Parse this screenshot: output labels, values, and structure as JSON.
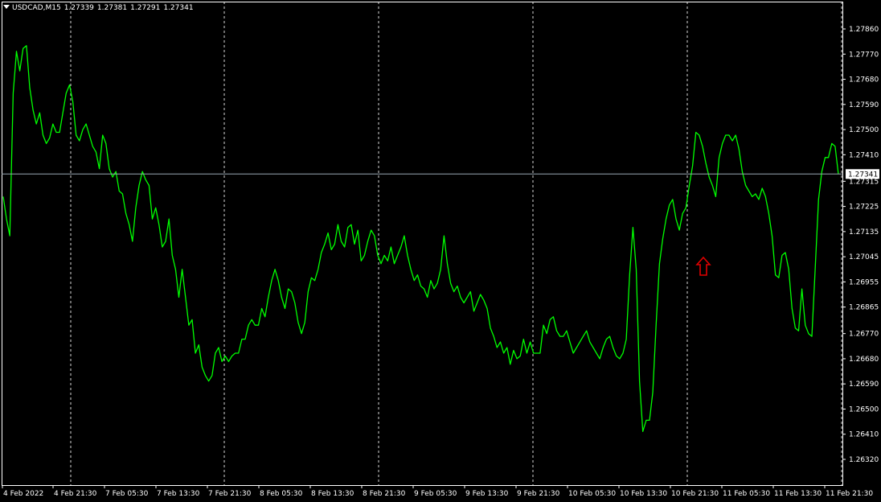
{
  "header": {
    "symbol_timeframe": "USDCAD,M15",
    "open": "1.27339",
    "high": "1.27381",
    "low": "1.27291",
    "close": "1.27341"
  },
  "colors": {
    "background": "#000000",
    "price_line": "#00ff00",
    "grid": "#ffffff",
    "bid_line": "#9aa8b4",
    "arrow": "#e00000",
    "text": "#ffffff"
  },
  "chart_data": {
    "type": "line",
    "symbol": "USDCAD",
    "timeframe": "M15",
    "ylim": [
      1.2632,
      1.2795
    ],
    "yticks": [
      "1.27860",
      "1.27770",
      "1.27680",
      "1.27590",
      "1.27500",
      "1.27410",
      "1.27315",
      "1.27225",
      "1.27135",
      "1.27045",
      "1.26955",
      "1.26865",
      "1.26770",
      "1.26680",
      "1.26590",
      "1.26500",
      "1.26410",
      "1.26320"
    ],
    "x_tick_labels": [
      "4 Feb 2022",
      "4 Feb 21:30",
      "7 Feb 05:30",
      "7 Feb 13:30",
      "7 Feb 21:30",
      "8 Feb 05:30",
      "8 Feb 13:30",
      "8 Feb 21:30",
      "9 Feb 05:30",
      "9 Feb 13:30",
      "9 Feb 21:30",
      "10 Feb 05:30",
      "10 Feb 13:30",
      "10 Feb 21:30",
      "11 Feb 05:30",
      "11 Feb 13:30",
      "11 Feb 21:30"
    ],
    "current_price": "1.27341",
    "grid": "vertical dashed",
    "series": [
      {
        "values": [
          1.2726,
          1.2718,
          1.2712,
          1.2763,
          1.2778,
          1.2771,
          1.2779,
          1.278,
          1.2765,
          1.2757,
          1.2752,
          1.2756,
          1.2748,
          1.2745,
          1.2747,
          1.2752,
          1.2749,
          1.2749,
          1.2756,
          1.2763,
          1.2766,
          1.276,
          1.2748,
          1.2746,
          1.275,
          1.2752,
          1.2748,
          1.2744,
          1.2742,
          1.2736,
          1.2748,
          1.2745,
          1.2736,
          1.2733,
          1.2735,
          1.2728,
          1.2727,
          1.272,
          1.2716,
          1.271,
          1.2722,
          1.273,
          1.2735,
          1.2732,
          1.273,
          1.2718,
          1.2722,
          1.2716,
          1.2708,
          1.271,
          1.2718,
          1.2705,
          1.27,
          1.269,
          1.27,
          1.269,
          1.268,
          1.2682,
          1.267,
          1.2673,
          1.2665,
          1.2662,
          1.266,
          1.2662,
          1.267,
          1.2672,
          1.2667,
          1.2669,
          1.2667,
          1.2669,
          1.267,
          1.267,
          1.2675,
          1.2675,
          1.268,
          1.2682,
          1.268,
          1.268,
          1.2686,
          1.2683,
          1.269,
          1.2696,
          1.27,
          1.2696,
          1.269,
          1.2686,
          1.2693,
          1.2692,
          1.2688,
          1.2681,
          1.2677,
          1.2681,
          1.2692,
          1.2697,
          1.2696,
          1.27,
          1.2706,
          1.2709,
          1.2713,
          1.2707,
          1.2709,
          1.2716,
          1.271,
          1.2708,
          1.2715,
          1.2716,
          1.2709,
          1.2714,
          1.2703,
          1.2705,
          1.271,
          1.2714,
          1.2712,
          1.2705,
          1.2702,
          1.2705,
          1.2703,
          1.2708,
          1.2702,
          1.2705,
          1.2708,
          1.2712,
          1.2705,
          1.27,
          1.2696,
          1.2698,
          1.2694,
          1.2693,
          1.269,
          1.2696,
          1.2693,
          1.2695,
          1.27,
          1.2712,
          1.2702,
          1.2695,
          1.2692,
          1.2694,
          1.269,
          1.2688,
          1.269,
          1.2692,
          1.2685,
          1.2688,
          1.2691,
          1.2689,
          1.2686,
          1.2679,
          1.2676,
          1.2672,
          1.2674,
          1.267,
          1.2672,
          1.2666,
          1.2671,
          1.2668,
          1.2669,
          1.2675,
          1.267,
          1.2674,
          1.267,
          1.267,
          1.267,
          1.268,
          1.2677,
          1.2682,
          1.2683,
          1.2678,
          1.2676,
          1.2676,
          1.2678,
          1.2674,
          1.267,
          1.2672,
          1.2674,
          1.2676,
          1.2678,
          1.2674,
          1.2672,
          1.267,
          1.2668,
          1.2672,
          1.2675,
          1.2676,
          1.2672,
          1.2669,
          1.2668,
          1.267,
          1.2675,
          1.2698,
          1.2715,
          1.27,
          1.266,
          1.2642,
          1.2646,
          1.2646,
          1.2656,
          1.268,
          1.2702,
          1.2711,
          1.2718,
          1.2723,
          1.2725,
          1.2718,
          1.2714,
          1.272,
          1.2722,
          1.273,
          1.2737,
          1.2749,
          1.2748,
          1.2744,
          1.2738,
          1.2733,
          1.273,
          1.2726,
          1.274,
          1.2745,
          1.2748,
          1.2748,
          1.2746,
          1.2748,
          1.2743,
          1.2735,
          1.273,
          1.2728,
          1.2726,
          1.2727,
          1.2725,
          1.2729,
          1.2726,
          1.272,
          1.2712,
          1.2698,
          1.2697,
          1.2705,
          1.2706,
          1.27,
          1.2686,
          1.2679,
          1.2678,
          1.2693,
          1.268,
          1.2677,
          1.2676,
          1.27,
          1.2725,
          1.2735,
          1.274,
          1.274,
          1.2745,
          1.2744,
          1.2734
        ]
      }
    ]
  }
}
